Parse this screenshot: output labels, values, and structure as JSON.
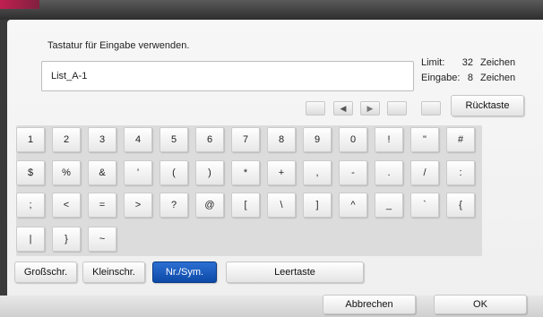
{
  "instruction": "Tastatur für Eingabe verwenden.",
  "input": {
    "value": "List_A-1"
  },
  "counters": {
    "limit_label": "Limit:",
    "limit_value": "32",
    "input_label": "Eingabe:",
    "input_value": "8",
    "unit": "Zeichen"
  },
  "backspace_label": "Rücktaste",
  "keys": {
    "row1": [
      "1",
      "2",
      "3",
      "4",
      "5",
      "6",
      "7",
      "8",
      "9",
      "0",
      "!",
      "\"",
      "#"
    ],
    "row2": [
      "$",
      "%",
      "&",
      "'",
      "(",
      ")",
      "*",
      "+",
      ",",
      "-",
      ".",
      "/",
      ":"
    ],
    "row3": [
      ";",
      "<",
      "=",
      ">",
      "?",
      "@",
      "[",
      "\\",
      "]",
      "^",
      "_",
      "`",
      "{"
    ],
    "row4": [
      "|",
      "}",
      "~"
    ]
  },
  "modes": {
    "upper": "Großschr.",
    "lower": "Kleinschr.",
    "numsym": "Nr./Sym.",
    "space": "Leertaste"
  },
  "footer": {
    "cancel": "Abbrechen",
    "ok": "OK"
  },
  "colors": {
    "selected_mode": "#0d4aa8",
    "accent": "#c02050"
  }
}
